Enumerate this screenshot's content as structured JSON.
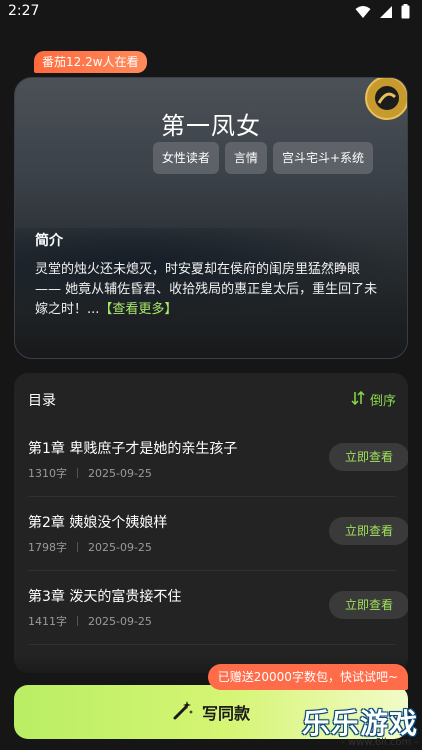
{
  "status_bar": {
    "time": "2:27"
  },
  "readers_badge": "番茄12.2w人在看",
  "book": {
    "title": "第一凤女",
    "tags": [
      "女性读者",
      "言情",
      "宫斗宅斗+系统"
    ],
    "intro_heading": "简介",
    "intro_text": "灵堂的烛火还未熄灭，时安夏却在侯府的闺房里猛然睁眼—— 她竟从辅佐昏君、收拾残局的惠正皇太后，重生回了未嫁之时！...",
    "see_more": "【查看更多】"
  },
  "toc": {
    "title": "目录",
    "sort_label": "倒序",
    "read_label": "立即查看",
    "chapters": [
      {
        "title": "第1章 卑贱庶子才是她的亲生孩子",
        "words": "1310字",
        "date": "2025-09-25"
      },
      {
        "title": "第2章 姨娘没个姨娘样",
        "words": "1798字",
        "date": "2025-09-25"
      },
      {
        "title": "第3章 泼天的富贵接不住",
        "words": "1411字",
        "date": "2025-09-25"
      }
    ]
  },
  "gift_badge": "已赠送20000字数包，快试试吧~",
  "write_button": "写同款",
  "watermark": {
    "text": "乐乐游戏",
    "url": "- www.6ll.com -"
  },
  "colors": {
    "accent": "#8ad84e",
    "badge": "#ff6a3d",
    "button_start": "#b9ee64"
  }
}
